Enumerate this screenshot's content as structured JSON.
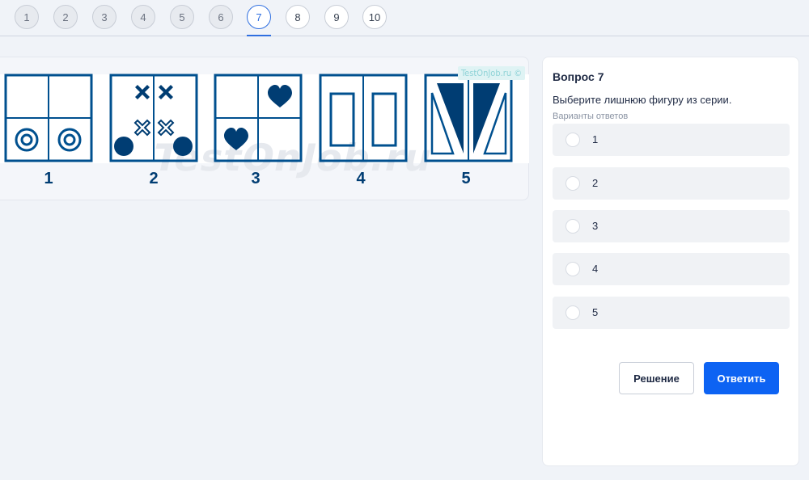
{
  "nav": {
    "questions": [
      "1",
      "2",
      "3",
      "4",
      "5",
      "6",
      "7",
      "8",
      "9",
      "10"
    ],
    "active": "7"
  },
  "figures": {
    "labels": [
      "1",
      "2",
      "3",
      "4",
      "5"
    ],
    "watermark": "TestOnJob.ru",
    "watermark_badge": "TestOnJob.ru ©",
    "colors": {
      "stroke": "#00508f",
      "fill": "#003d73"
    }
  },
  "question": {
    "title": "Вопрос 7",
    "text": "Выберите лишнюю фигуру из серии.",
    "hint": "Варианты ответов",
    "options": [
      "1",
      "2",
      "3",
      "4",
      "5"
    ],
    "solution_label": "Решение",
    "answer_label": "Ответить"
  },
  "colors": {
    "accent": "#0d63f3",
    "background": "#f0f3f8"
  }
}
